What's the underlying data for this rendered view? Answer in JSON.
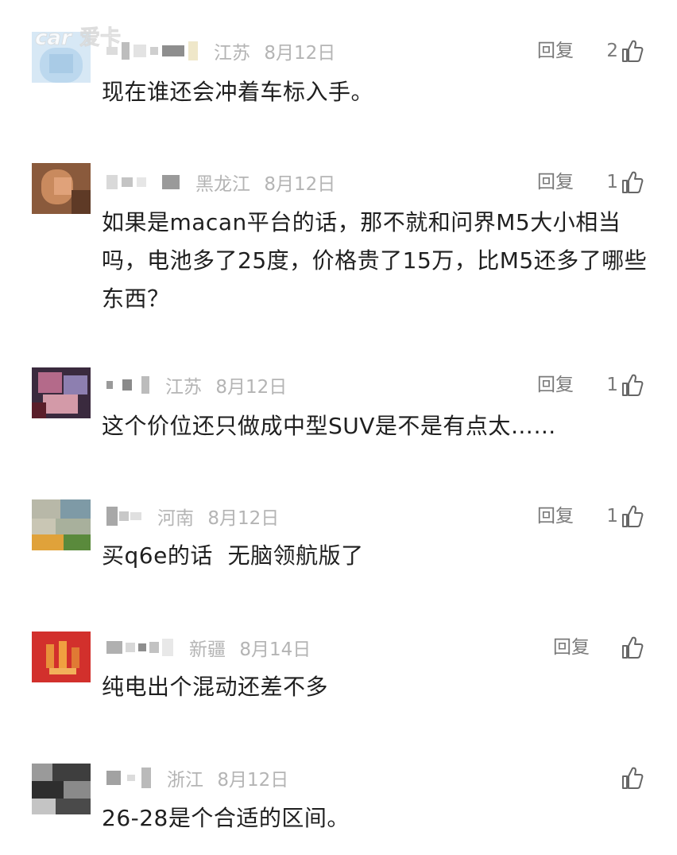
{
  "watermark": {
    "text": "爱卡"
  },
  "comments": [
    {
      "region": "江苏",
      "date": "8月12日",
      "reply_label": "回复",
      "likes": "2",
      "text": "现在谁还会冲着车标入手。"
    },
    {
      "region": "黑龙江",
      "date": "8月12日",
      "reply_label": "回复",
      "likes": "1",
      "text": "如果是macan平台的话，那不就和问界M5大小相当吗，电池多了25度，价格贵了15万，比M5还多了哪些东西？"
    },
    {
      "region": "江苏",
      "date": "8月12日",
      "reply_label": "回复",
      "likes": "1",
      "text": "这个价位还只做成中型SUV是不是有点太……"
    },
    {
      "region": "河南",
      "date": "8月12日",
      "reply_label": "回复",
      "likes": "1",
      "text": "买q6e的话  无脑领航版了"
    },
    {
      "region": "新疆",
      "date": "8月14日",
      "reply_label": "回复",
      "likes": "",
      "text": "纯电出个混动还差不多"
    },
    {
      "region": "浙江",
      "date": "8月12日",
      "reply_label": "",
      "likes": "",
      "text": "26-28是个合适的区间。"
    }
  ],
  "colors": {
    "text": "#1f1f1f",
    "meta": "#b4b4b4",
    "action": "#7a7a7a",
    "background": "#ffffff"
  }
}
